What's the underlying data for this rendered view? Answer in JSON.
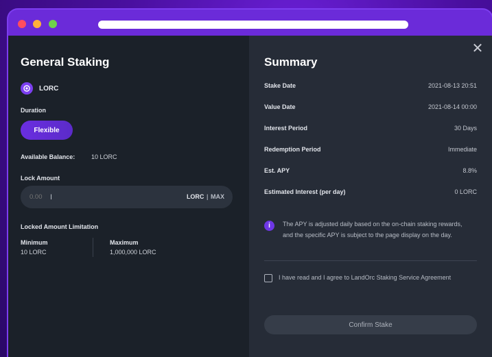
{
  "browser": {
    "url": ""
  },
  "left": {
    "title": "General Staking",
    "token": {
      "name": "LORC",
      "icon": "lorc-token-icon"
    },
    "duration_label": "Duration",
    "duration_option": "Flexible",
    "available_balance_label": "Available Balance:",
    "available_balance_value": "10 LORC",
    "lock_amount_label": "Lock Amount",
    "lock_amount_value": "0.00",
    "lock_unit": "LORC",
    "separator": "|",
    "max_label": "MAX",
    "limitation_label": "Locked Amount Limitation",
    "minimum_label": "Minimum",
    "minimum_value": "10 LORC",
    "maximum_label": "Maximum",
    "maximum_value": "1,000,000 LORC"
  },
  "right": {
    "title": "Summary",
    "rows": [
      {
        "key": "Stake Date",
        "value": "2021-08-13 20:51"
      },
      {
        "key": "Value Date",
        "value": "2021-08-14 00:00"
      },
      {
        "key": "Interest Period",
        "value": "30 Days"
      },
      {
        "key": "Redemption Period",
        "value": "Immediate"
      },
      {
        "key": "Est. APY",
        "value": "8.8%"
      },
      {
        "key": "Estimated Interest (per day)",
        "value": "0 LORC"
      }
    ],
    "notice": "The APY is adjusted daily based on the on-chain staking rewards, and the specific APY is subject to the page display on the day.",
    "agreement": "I have read and I agree to  LandOrc Staking Service Agreement",
    "confirm_label": "Confirm Stake",
    "close_glyph": "✕",
    "info_glyph": "i"
  },
  "colors": {
    "accent": "#6a2ee0",
    "left_panel": "#1b2129",
    "right_panel": "#262c37"
  }
}
